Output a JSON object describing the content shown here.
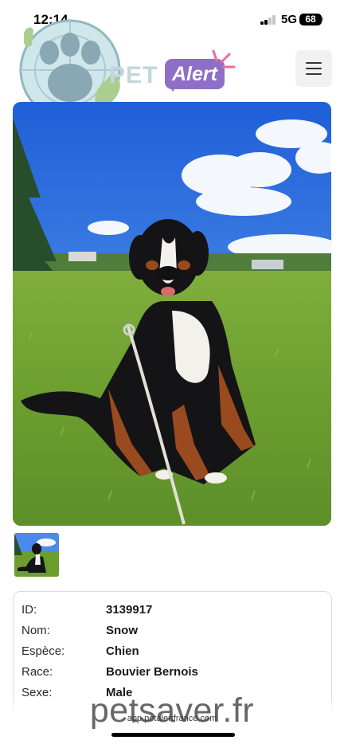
{
  "status_bar": {
    "time": "12:14",
    "network": "5G",
    "battery": "68"
  },
  "header": {
    "brand_pet": "PET",
    "brand_alert": "Alert",
    "colors": {
      "pet": "#c2d6dc",
      "alert_bg": "#8e6fc6",
      "spark": "#f06aa0"
    }
  },
  "photo": {
    "subject": "bernese-mountain-dog"
  },
  "info": {
    "rows": [
      {
        "label": "ID:",
        "value": "3139917"
      },
      {
        "label": "Nom:",
        "value": "Snow"
      },
      {
        "label": "Espèce:",
        "value": "Chien"
      },
      {
        "label": "Race:",
        "value": "Bouvier Bernois"
      },
      {
        "label": "Sexe:",
        "value": "Male"
      }
    ]
  },
  "browser": {
    "url": "app.petalertfrance.com"
  },
  "watermark": "petsaver.fr"
}
